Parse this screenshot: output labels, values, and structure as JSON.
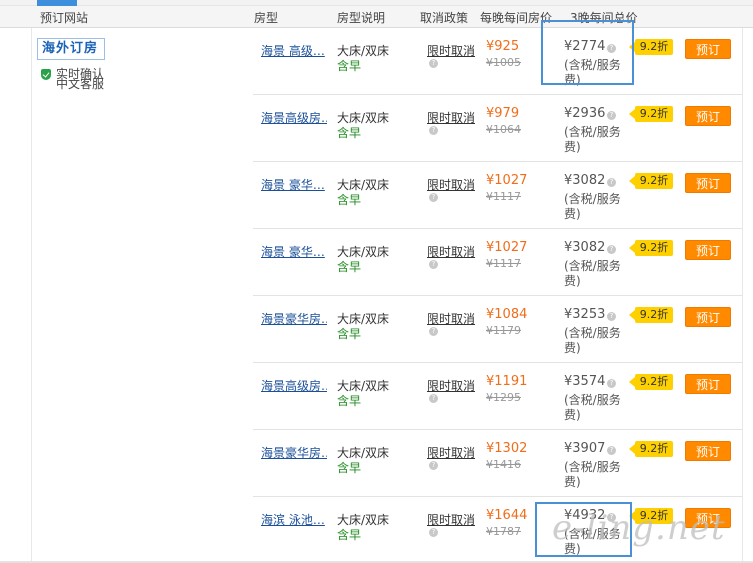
{
  "header": {
    "site": "预订网站",
    "room_type": "房型",
    "room_desc": "房型说明",
    "cancel": "取消政策",
    "nightly": "每晚每间房价",
    "total": "3晚每间总价"
  },
  "site": {
    "logo": "海外订房",
    "confirm_line1": "实时确认",
    "confirm_line2": "中文客服"
  },
  "colors": {
    "accent": "#3e8ede",
    "book_button": "#ff8a00",
    "discount_badge": "#ffd000",
    "price": "#f06d1a",
    "meal": "#1e8b1e",
    "link": "#1a4f99"
  },
  "rows": [
    {
      "room": "海景 高级…",
      "bed": "大床/双床",
      "meal": "含早",
      "policy": "限时取消",
      "price": "¥925",
      "orig": "¥1005",
      "total": "¥2774",
      "tax1": "(含税/服务",
      "tax2": "费)",
      "discount": "9.2折",
      "book": "预订"
    },
    {
      "room": "海景高级房…",
      "bed": "大床/双床",
      "meal": "含早",
      "policy": "限时取消",
      "price": "¥979",
      "orig": "¥1064",
      "total": "¥2936",
      "tax1": "(含税/服务",
      "tax2": "费)",
      "discount": "9.2折",
      "book": "预订"
    },
    {
      "room": "海景 豪华…",
      "bed": "大床/双床",
      "meal": "含早",
      "policy": "限时取消",
      "price": "¥1027",
      "orig": "¥1117",
      "total": "¥3082",
      "tax1": "(含税/服务",
      "tax2": "费)",
      "discount": "9.2折",
      "book": "预订"
    },
    {
      "room": "海景 豪华…",
      "bed": "大床/双床",
      "meal": "含早",
      "policy": "限时取消",
      "price": "¥1027",
      "orig": "¥1117",
      "total": "¥3082",
      "tax1": "(含税/服务",
      "tax2": "费)",
      "discount": "9.2折",
      "book": "预订"
    },
    {
      "room": "海景豪华房…",
      "bed": "大床/双床",
      "meal": "含早",
      "policy": "限时取消",
      "price": "¥1084",
      "orig": "¥1179",
      "total": "¥3253",
      "tax1": "(含税/服务",
      "tax2": "费)",
      "discount": "9.2折",
      "book": "预订"
    },
    {
      "room": "海景高级房…",
      "bed": "大床/双床",
      "meal": "含早",
      "policy": "限时取消",
      "price": "¥1191",
      "orig": "¥1295",
      "total": "¥3574",
      "tax1": "(含税/服务",
      "tax2": "费)",
      "discount": "9.2折",
      "book": "预订"
    },
    {
      "room": "海景豪华房…",
      "bed": "大床/双床",
      "meal": "含早",
      "policy": "限时取消",
      "price": "¥1302",
      "orig": "¥1416",
      "total": "¥3907",
      "tax1": "(含税/服务",
      "tax2": "费)",
      "discount": "9.2折",
      "book": "预订"
    },
    {
      "room": "海滨 泳池…",
      "bed": "大床/双床",
      "meal": "含早",
      "policy": "限时取消",
      "price": "¥1644",
      "orig": "¥1787",
      "total": "¥4932",
      "tax1": "(含税/服务",
      "tax2": "费)",
      "discount": "9.2折",
      "book": "预订"
    }
  ],
  "watermark": "e-ling.net"
}
